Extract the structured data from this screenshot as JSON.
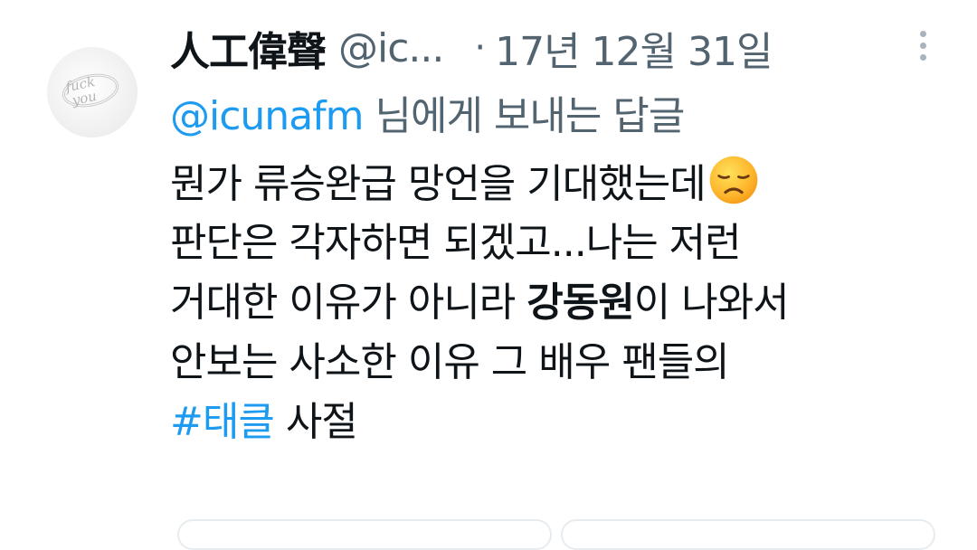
{
  "tweet": {
    "display_name": "人工偉聲",
    "handle": "@ic...",
    "separator": "·",
    "timestamp": "17년 12월 31일",
    "reply_mention": "@icunafm",
    "reply_suffix": " 님에게 보내는 답글",
    "body": {
      "line1": "뭔가 류승완급 망언을 기대했는데",
      "line2": "판단은 각자하면 되겠고...나는 저런",
      "line3_start": "거대한 이유가 아니라 ",
      "line3_bold": "강동원",
      "line3_end": "이 나와서",
      "line4": "안보는 사소한 이유 그 배우 팬들의",
      "line5_hashtag": "#태클",
      "line5_end": " 사절"
    },
    "avatar_text": "fuck you"
  },
  "icons": {
    "avatar": "ring-avatar",
    "more": "more-vertical-icon",
    "emoji": "disappointed-face-emoji"
  },
  "colors": {
    "link": "#1d9bf0",
    "secondary_text": "#536471",
    "primary_text": "#0f1419"
  }
}
